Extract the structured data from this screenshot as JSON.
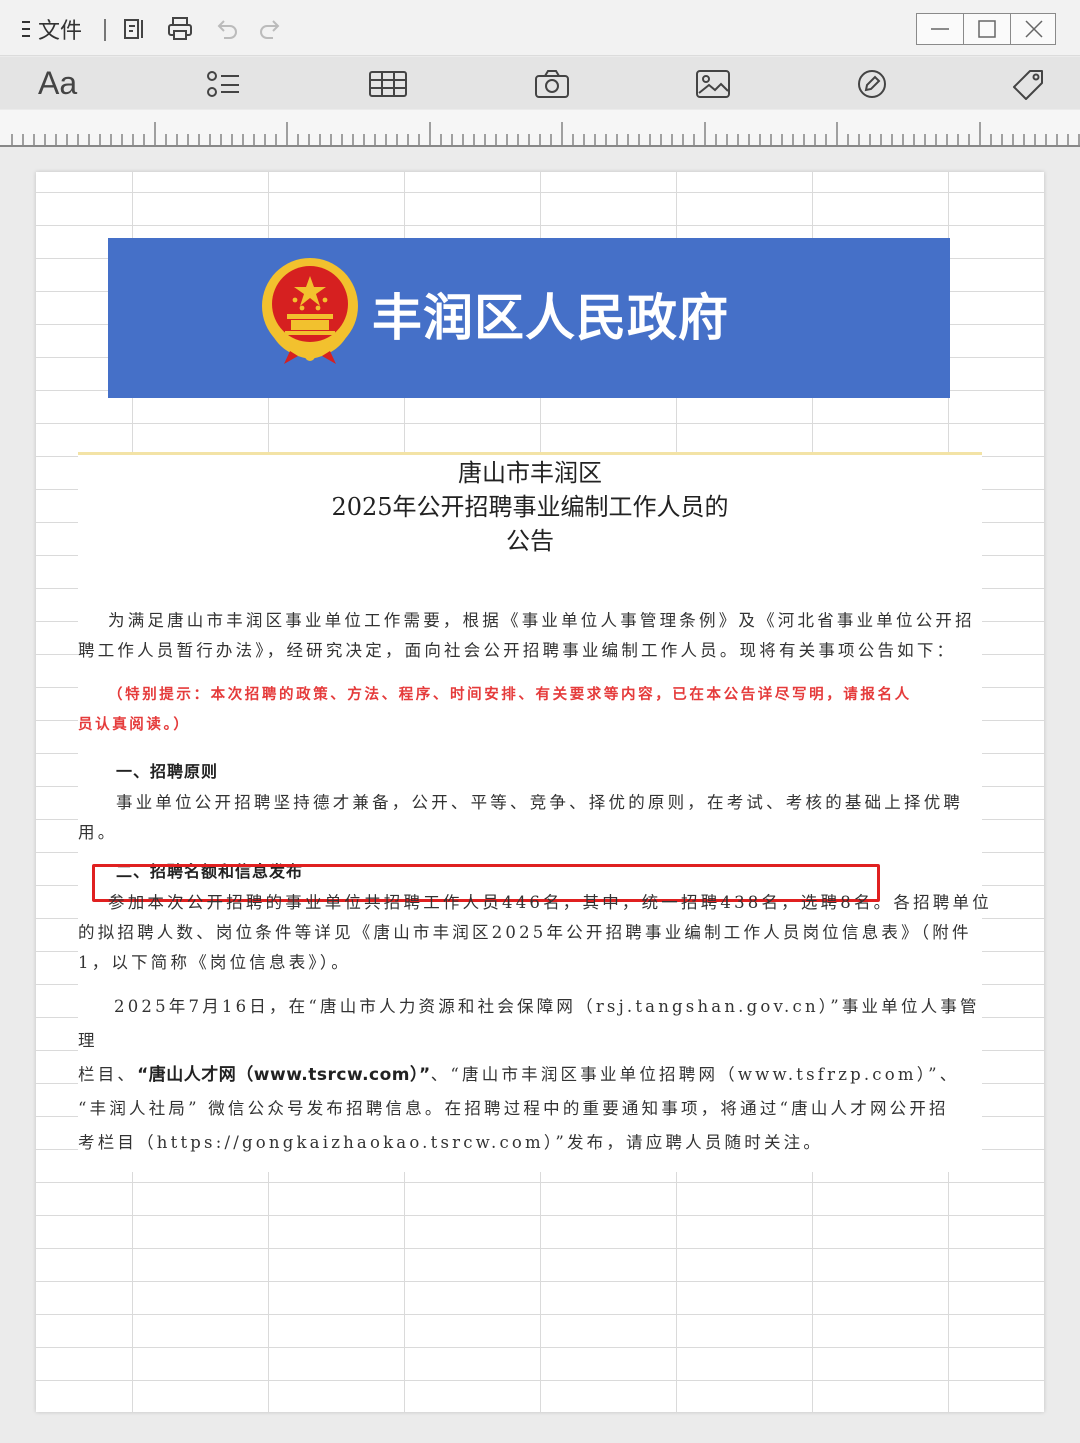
{
  "titlebar": {
    "menu_label": "文件"
  },
  "icons": {
    "list_view": "list-view-icon",
    "print": "print-icon",
    "undo": "undo-icon",
    "redo": "redo-icon",
    "minimize": "minimize-icon",
    "maximize": "maximize-icon",
    "close": "close-icon"
  },
  "toolbar": {
    "font_label": "Aa",
    "tools": [
      "list-bullets-icon",
      "table-icon",
      "camera-icon",
      "image-icon",
      "pen-icon",
      "tag-icon"
    ]
  },
  "banner": {
    "title": "丰润区人民政府"
  },
  "notice": {
    "title_line1": "唐山市丰润区",
    "title_line2": "2025年公开招聘事业编制工作人员的",
    "title_line3": "公告",
    "intro_line1": "为满足唐山市丰润区事业单位工作需要，根据《事业单位人事管理条例》及《河北省事业单位公开招",
    "intro_line2": "聘工作人员暂行办法》，经研究决定，面向社会公开招聘事业编制工作人员。现将有关事项公告如下：",
    "tip_line1": "（特别提示：本次招聘的政策、方法、程序、时间安排、有关要求等内容，已在本公告详尽写明，请报名人",
    "tip_line2": "员认真阅读。）",
    "section1_heading": "一、招聘原则",
    "section1_line1": "事业单位公开招聘坚持德才兼备，公开、平等、竞争、择优的原则，在考试、考核的基础上择优聘",
    "section1_line2": "用。",
    "section2_heading": "二、招聘名额和信息发布",
    "section2_highlight": "参加本次公开招聘的事业单位共招聘工作人员446名，其中，统一招聘438名，选聘8名。",
    "section2_line1_rest": "各招聘单位",
    "section2_line2": "的拟招聘人数、岗位条件等详见《唐山市丰润区2025年公开招聘事业编制工作人员岗位信息表》（附件",
    "section2_line3": "1，以下简称《岗位信息表》）。",
    "section3_line1": "2025年7月16日，在“唐山市人力资源和社会保障网（rsj.tangshan.gov.cn）”事业单位人事管理",
    "section3_line2_a": "栏目、",
    "section3_line2_b": "“唐山人才网（www.tsrcw.com）”",
    "section3_line2_c": "、“唐山市丰润区事业单位招聘网（www.tsfrzp.com）”、",
    "section3_line3": "“丰润人社局” 微信公众号发布招聘信息。在招聘过程中的重要通知事项，将通过“唐山人才网公开招",
    "section3_line4": "考栏目（https://gongkaizhaokao.tsrcw.com）”发布，请应聘人员随时关注。"
  },
  "colors": {
    "banner_blue": "#4570c8",
    "tip_red": "#e53b3b",
    "highlight_red": "#e02020"
  }
}
